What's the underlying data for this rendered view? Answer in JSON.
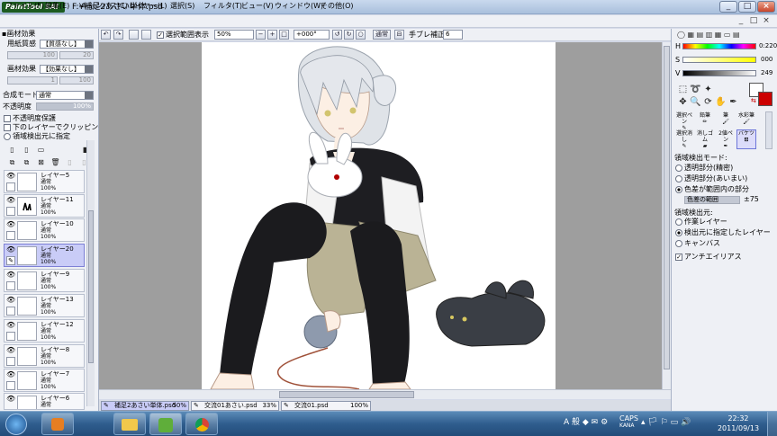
{
  "window": {
    "logo_text": "PaintTool SAI",
    "title": "F:¥補足2あさい単体.psd",
    "buttons": [
      "_",
      "□",
      "×"
    ]
  },
  "menu": {
    "items": [
      "ファイル(F)",
      "編集(E)",
      "キャンバス(C)",
      "レイヤー(L)",
      "選択(S)",
      "フィルタ(T)",
      "ビュー(V)",
      "ウィンドウ(W)",
      "その他(O)"
    ],
    "right_buttons": [
      "_",
      "□",
      "×"
    ]
  },
  "toolbar": {
    "show_selection_label": "選択範囲表示",
    "zoom_value": "50%",
    "rotation_value": "+000°",
    "blend_mode": "通常",
    "stabilizer_label": "手ブレ補正",
    "stabilizer_value": "6"
  },
  "left_panel": {
    "material_header": "画材効果",
    "paper_label": "用紙質感",
    "paper_value": "【質感なし】",
    "paper_slider_value": "20",
    "paper_slider2_value": "100",
    "effect_label": "画材効果",
    "effect_value": "【効果なし】",
    "effect_slider_value": "1",
    "effect_slider2_value": "100",
    "blend_label": "合成モード",
    "blend_value": "通常",
    "opacity_label": "不透明度",
    "opacity_value": "100%",
    "opacity_fraction": 1.0,
    "checks": [
      "不透明度保護",
      "下のレイヤーでクリッピング",
      "領域検出元に指定"
    ],
    "layers": [
      {
        "name": "レイヤー5",
        "mode": "通常",
        "opacity": "100%"
      },
      {
        "name": "レイヤー11",
        "mode": "通常",
        "opacity": "100%"
      },
      {
        "name": "レイヤー10",
        "mode": "通常",
        "opacity": "100%"
      },
      {
        "name": "レイヤー20",
        "mode": "通常",
        "opacity": "100%"
      },
      {
        "name": "レイヤー9",
        "mode": "通常",
        "opacity": "100%"
      },
      {
        "name": "レイヤー13",
        "mode": "通常",
        "opacity": "100%"
      },
      {
        "name": "レイヤー12",
        "mode": "通常",
        "opacity": "100%"
      },
      {
        "name": "レイヤー8",
        "mode": "通常",
        "opacity": "100%"
      },
      {
        "name": "レイヤー7",
        "mode": "通常",
        "opacity": "100%"
      },
      {
        "name": "レイヤー6",
        "mode": "通常",
        "opacity": "100%"
      }
    ]
  },
  "doc_tabs": [
    {
      "name": "補足2あさい単体.psd",
      "zoom": "50%"
    },
    {
      "name": "交流01あさい.psd",
      "zoom": "33%"
    },
    {
      "name": "交流01.psd",
      "zoom": "100%"
    }
  ],
  "right_panel": {
    "h_label": "H",
    "h_value": "0:220",
    "s_label": "S",
    "s_value": "000",
    "v_label": "V",
    "v_value": "249",
    "brushes": [
      {
        "label": "選択ペン"
      },
      {
        "label": "鉛筆"
      },
      {
        "label": "筆"
      },
      {
        "label": "水彩筆"
      },
      {
        "label": "選択消し"
      },
      {
        "label": "消しゴム"
      },
      {
        "label": "2値ペン"
      },
      {
        "label": "バケツ"
      }
    ],
    "detect_mode_title": "領域検出モード:",
    "detect_modes": [
      "透明部分(精密)",
      "透明部分(あいまい)",
      "色差が範囲内の部分"
    ],
    "color_diff_label": "色差の範囲",
    "color_diff_value": "±75",
    "source_title": "領域検出元:",
    "sources": [
      "作業レイヤー",
      "検出元に指定したレイヤー",
      "キャンバス"
    ],
    "antialias_label": "アンチエイリアス"
  },
  "taskbar": {
    "caps": "CAPS",
    "kana": "KANA",
    "time": "22:32",
    "date": "2011/09/13"
  },
  "colors": {
    "accent": "#c9ccf7",
    "primary_color": "#ffffff",
    "secondary_color": "#cc0000"
  }
}
